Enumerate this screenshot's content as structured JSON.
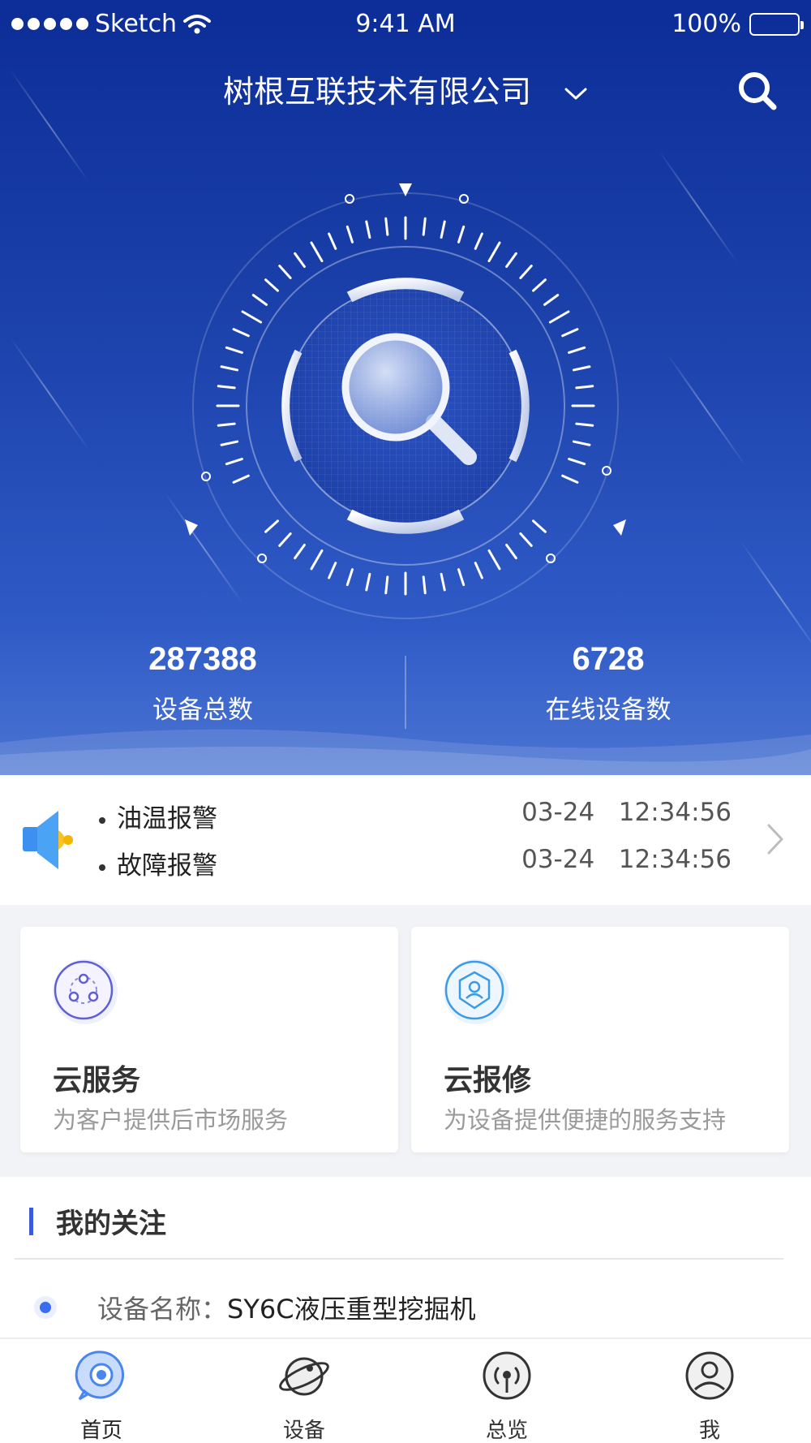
{
  "status_bar": {
    "carrier": "Sketch",
    "time": "9:41 AM",
    "battery": "100%"
  },
  "header": {
    "company": "树根互联技术有限公司"
  },
  "stats": [
    {
      "value": "287388",
      "label": "设备总数"
    },
    {
      "value": "6728",
      "label": "在线设备数"
    }
  ],
  "alerts": [
    {
      "title": "油温报警",
      "date": "03-24",
      "time": "12:34:56"
    },
    {
      "title": "故障报警",
      "date": "03-24",
      "time": "12:34:56"
    }
  ],
  "cards": [
    {
      "title": "云服务",
      "subtitle": "为客户提供后市场服务",
      "icon": "cloud-service-icon"
    },
    {
      "title": "云报修",
      "subtitle": "为设备提供便捷的服务支持",
      "icon": "cloud-repair-icon"
    }
  ],
  "follow": {
    "heading": "我的关注",
    "items": [
      {
        "label": "设备名称：",
        "value": "SY6C液压重型挖掘机"
      }
    ]
  },
  "tabs": [
    {
      "label": "首页",
      "icon": "home-icon",
      "active": true
    },
    {
      "label": "设备",
      "icon": "device-planet-icon",
      "active": false
    },
    {
      "label": "总览",
      "icon": "overview-signal-icon",
      "active": false
    },
    {
      "label": "我",
      "icon": "profile-icon",
      "active": false
    }
  ],
  "colors": {
    "hero_top": "#0c2d97",
    "hero_bottom": "#4a74d2",
    "accent": "#3b5bdb"
  }
}
